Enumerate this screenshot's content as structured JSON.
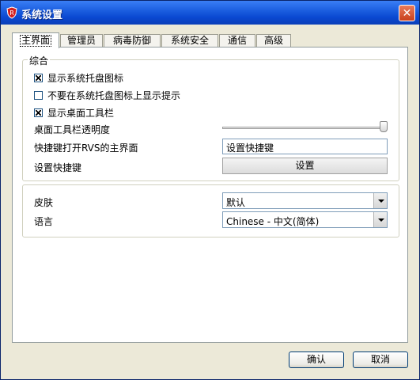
{
  "window": {
    "title": "系统设置",
    "close_glyph": "✕",
    "icon": "shield-app-icon"
  },
  "tabs": [
    {
      "label": "主界面",
      "active": true
    },
    {
      "label": "管理员",
      "active": false
    },
    {
      "label": "病毒防御",
      "active": false
    },
    {
      "label": "系统安全",
      "active": false
    },
    {
      "label": "通信",
      "active": false
    },
    {
      "label": "高级",
      "active": false
    }
  ],
  "general": {
    "group_title": "综合",
    "show_tray_icon": {
      "label": "显示系统托盘图标",
      "checked": true
    },
    "no_tray_tips": {
      "label": "不要在系统托盘图标上显示提示",
      "checked": false
    },
    "show_desktop_toolbar": {
      "label": "显示桌面工具栏",
      "checked": true
    },
    "toolbar_opacity": {
      "label": "桌面工具栏透明度",
      "value": 1.0
    },
    "hotkey_open": {
      "label": "快捷键打开RVS的主界面",
      "value": "设置快捷键"
    },
    "set_hotkey": {
      "label": "设置快捷键",
      "button": "设置"
    }
  },
  "appearance": {
    "skin": {
      "label": "皮肤",
      "value": "默认"
    },
    "language": {
      "label": "语言",
      "value": "Chinese - 中文(简体)"
    }
  },
  "footer": {
    "ok": "确认",
    "cancel": "取消"
  }
}
